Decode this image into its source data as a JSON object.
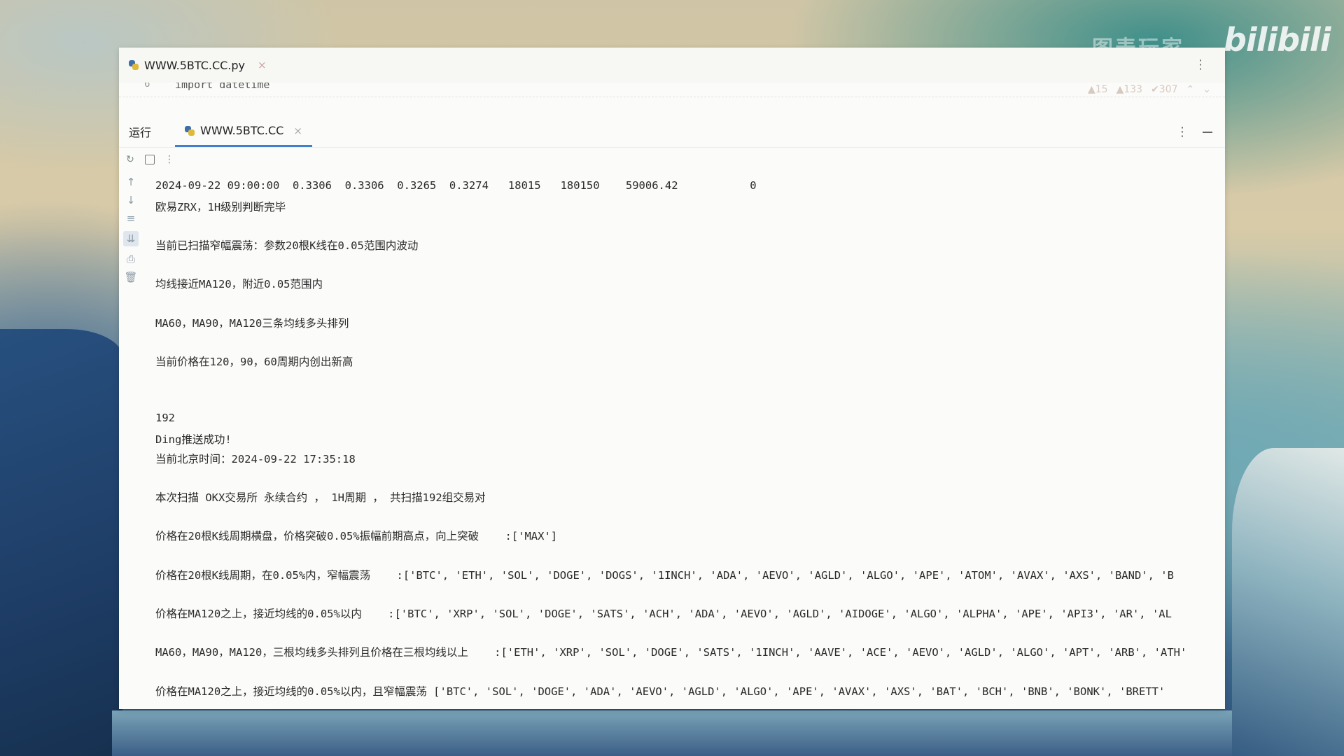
{
  "window": {
    "editor_tab": "WWW.5BTC.CC.py",
    "editor_peek_line_no": "6",
    "editor_peek_code": "import datetime",
    "inspections": [
      "▲15",
      "▲133",
      "✔307",
      "⌃",
      "⌄"
    ]
  },
  "run": {
    "title": "运行",
    "tab": "WWW.5BTC.CC",
    "tab_close": "×"
  },
  "watermark": {
    "text": "图表玩家",
    "logo": "bilibili"
  },
  "console": {
    "lines": [
      {
        "text": "2024-09-22 09:00:00  0.3306  0.3306  0.3265  0.3274   18015   180150    59006.42           0"
      },
      {
        "text": "欧易ZRX，1H级别判断完毕"
      },
      {
        "text": "当前已扫描窄幅震荡：参数20根K线在0.05范围内波动"
      },
      {
        "text": "均线接近MA120，附近0.05范围内"
      },
      {
        "text": "MA60，MA90，MA120三条均线多头排列"
      },
      {
        "text": "当前价格在120，90，60周期内创出新高"
      },
      {
        "text": "192"
      },
      {
        "text": "Ding推送成功!"
      },
      {
        "text": "当前北京时间：2024-09-22 17:35:18"
      },
      {
        "text": "本次扫描 OKX交易所 永续合约 ， 1H周期 ， 共扫描192组交易对"
      },
      {
        "text": "价格在20根K线周期横盘，价格突破0.05%振幅前期高点，向上突破    :['MAX']"
      },
      {
        "text": "价格在20根K线周期，在0.05%内，窄幅震荡    :['BTC', 'ETH', 'SOL', 'DOGE', 'DOGS', '1INCH', 'ADA', 'AEVO', 'AGLD', 'ALGO', 'APE', 'ATOM', 'AVAX', 'AXS', 'BAND', 'B"
      },
      {
        "text": "价格在MA120之上，接近均线的0.05%以内    :['BTC', 'XRP', 'SOL', 'DOGE', 'SATS', 'ACH', 'ADA', 'AEVO', 'AGLD', 'AIDOGE', 'ALGO', 'ALPHA', 'APE', 'API3', 'AR', 'AL"
      },
      {
        "text": "MA60，MA90，MA120，三根均线多头排列且价格在三根均线以上    :['ETH', 'XRP', 'SOL', 'DOGE', 'SATS', '1INCH', 'AAVE', 'ACE', 'AEVO', 'AGLD', 'ALGO', 'APT', 'ARB', 'ATH'"
      },
      {
        "text": "价格在MA120之上，接近均线的0.05%以内，且窄幅震荡 ['BTC', 'SOL', 'DOGE', 'ADA', 'AEVO', 'AGLD', 'ALGO', 'APE', 'AVAX', 'AXS', 'BAT', 'BCH', 'BNB', 'BONK', 'BRETT'"
      }
    ]
  },
  "icons": {
    "rerun": "↻",
    "stop": "stop-square",
    "more": "⋮",
    "up": "↑",
    "down": "↓",
    "wrap": "≡",
    "scroll": "⇊",
    "print": "⎙",
    "trash": "🗑"
  }
}
